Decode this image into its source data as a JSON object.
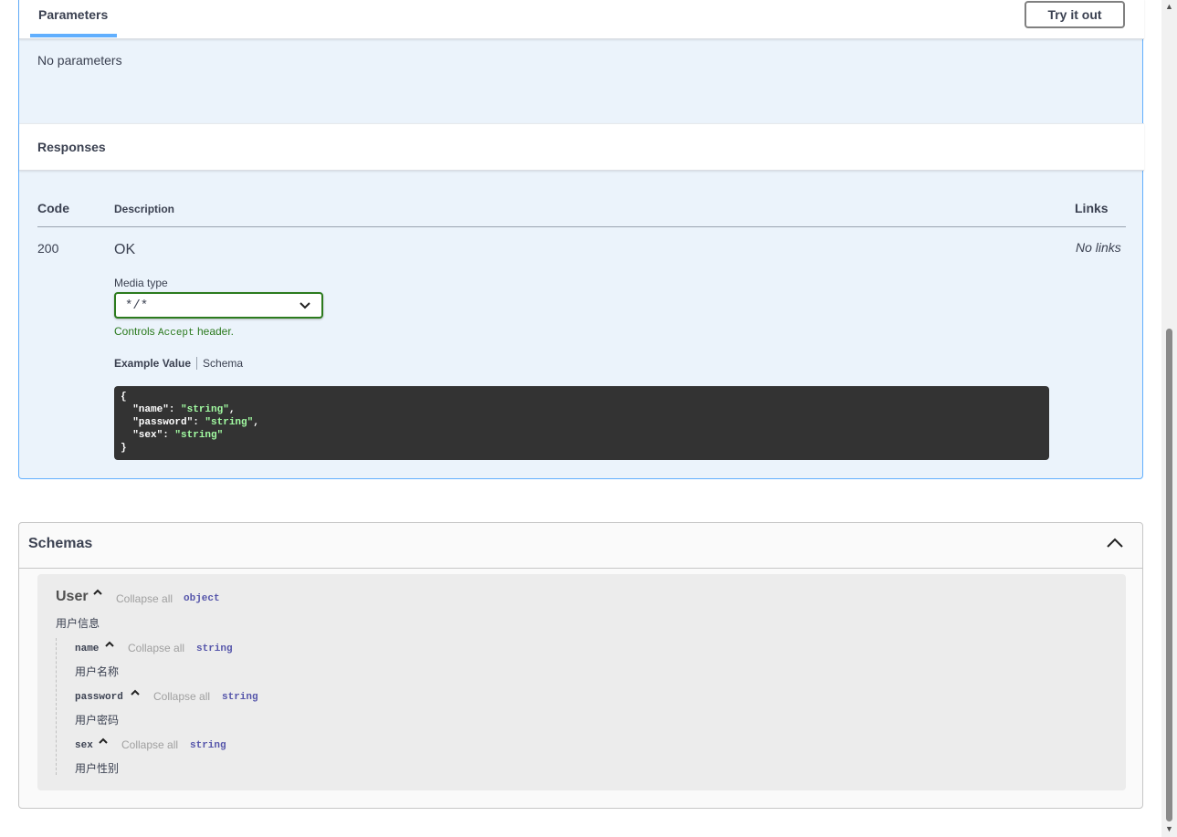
{
  "parameters": {
    "tab_label": "Parameters",
    "try_button": "Try it out",
    "empty_text": "No parameters"
  },
  "responses": {
    "title": "Responses",
    "columns": {
      "code": "Code",
      "description": "Description",
      "links": "Links"
    },
    "rows": [
      {
        "code": "200",
        "description": "OK",
        "links": "No links",
        "media_type_label": "Media type",
        "media_type_value": "*/*",
        "controls_prefix": "Controls ",
        "controls_code": "Accept",
        "controls_suffix": " header.",
        "example_tabs": [
          "Example Value",
          "Schema"
        ],
        "example_json": {
          "open": "{",
          "lines": [
            {
              "key": "\"name\"",
              "value": "\"string\"",
              "comma": ","
            },
            {
              "key": "\"password\"",
              "value": "\"string\"",
              "comma": ","
            },
            {
              "key": "\"sex\"",
              "value": "\"string\"",
              "comma": ""
            }
          ],
          "close": "}"
        }
      }
    ]
  },
  "schemas": {
    "title": "Schemas",
    "toggle_icon": "chevron-up-icon",
    "models": [
      {
        "name": "User",
        "collapse_label": "Collapse all",
        "type": "object",
        "description": "用户信息",
        "properties": [
          {
            "name": "name",
            "collapse_label": "Collapse all",
            "type": "string",
            "description": "用户名称"
          },
          {
            "name": "password",
            "collapse_label": "Collapse all",
            "type": "string",
            "description": "用户密码"
          },
          {
            "name": "sex",
            "collapse_label": "Collapse all",
            "type": "string",
            "description": "用户性别"
          }
        ]
      }
    ]
  },
  "colors": {
    "accent_blue": "#61affe",
    "select_border": "#2c7b1e",
    "json_string": "#a2fca2",
    "code_bg": "#333333"
  }
}
